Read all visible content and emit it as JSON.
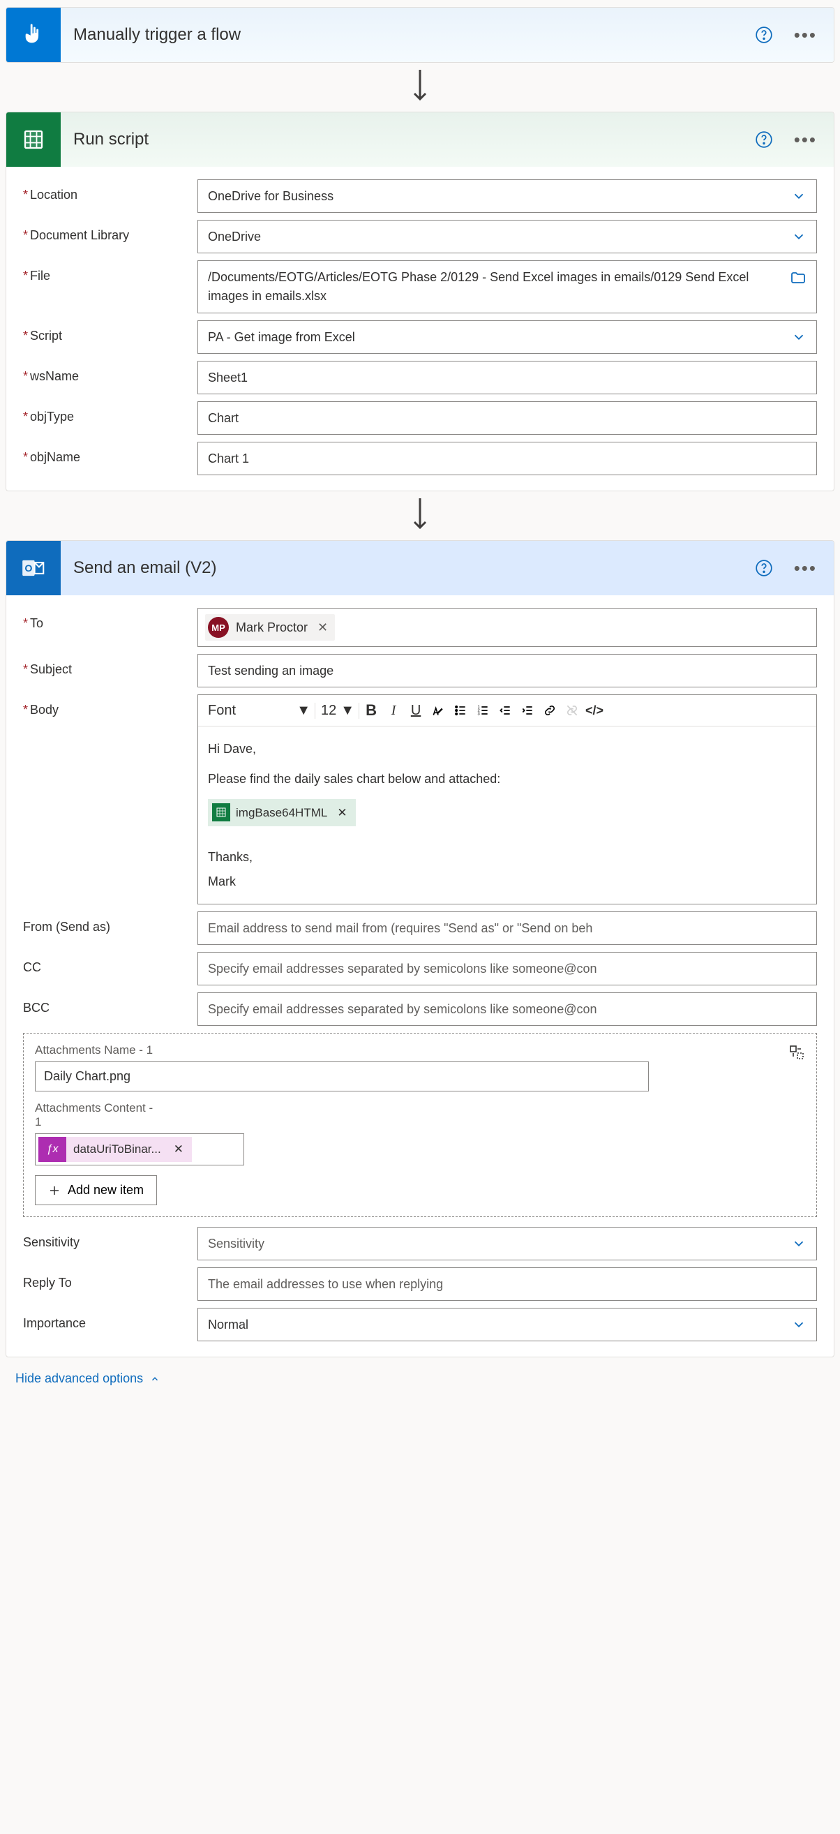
{
  "trigger": {
    "title": "Manually trigger a flow"
  },
  "runScript": {
    "title": "Run script",
    "fields": {
      "location_label": "Location",
      "location_value": "OneDrive for Business",
      "doclib_label": "Document Library",
      "doclib_value": "OneDrive",
      "file_label": "File",
      "file_value": "/Documents/EOTG/Articles/EOTG Phase 2/0129 - Send Excel images in emails/0129 Send Excel images in emails.xlsx",
      "script_label": "Script",
      "script_value": "PA - Get image from Excel",
      "wsname_label": "wsName",
      "wsname_value": "Sheet1",
      "objtype_label": "objType",
      "objtype_value": "Chart",
      "objname_label": "objName",
      "objname_value": "Chart 1"
    }
  },
  "sendEmail": {
    "title": "Send an email (V2)",
    "to_label": "To",
    "recipient_initials": "MP",
    "recipient_name": "Mark Proctor",
    "subject_label": "Subject",
    "subject_value": "Test sending an image",
    "body_label": "Body",
    "rte": {
      "font_label": "Font",
      "size_label": "12",
      "greeting": "Hi Dave,",
      "line1": "Please find the daily sales chart below and attached:",
      "token_label": "imgBase64HTML",
      "thanks": "Thanks,",
      "signoff": "Mark"
    },
    "from_label": "From (Send as)",
    "from_placeholder": "Email address to send mail from (requires \"Send as\" or \"Send on beh",
    "cc_label": "CC",
    "cc_placeholder": "Specify email addresses separated by semicolons like someone@con",
    "bcc_label": "BCC",
    "bcc_placeholder": "Specify email addresses separated by semicolons like someone@con",
    "attachments": {
      "name_label": "Attachments Name - 1",
      "name_value": "Daily Chart.png",
      "content_label": "Attachments Content - 1",
      "fx_label": "dataUriToBinar...",
      "add_item": "Add new item"
    },
    "sensitivity_label": "Sensitivity",
    "sensitivity_placeholder": "Sensitivity",
    "replyto_label": "Reply To",
    "replyto_placeholder": "The email addresses to use when replying",
    "importance_label": "Importance",
    "importance_value": "Normal",
    "hide_advanced": "Hide advanced options"
  }
}
